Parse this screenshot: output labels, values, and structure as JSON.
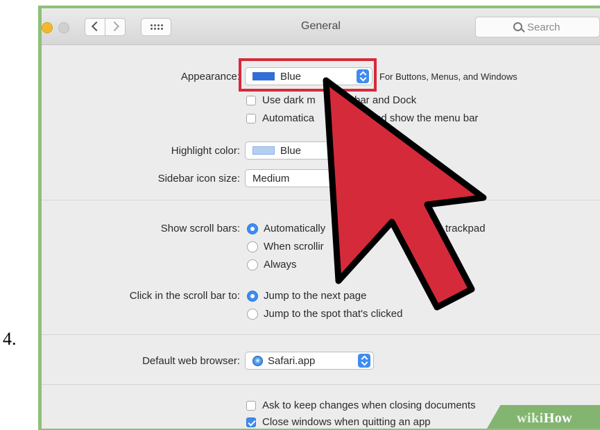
{
  "step": {
    "number": "4."
  },
  "window": {
    "title": "General",
    "search_placeholder": "Search"
  },
  "appearance": {
    "label": "Appearance:",
    "value": "Blue",
    "note": "For Buttons, Menus, and Windows",
    "swatch_color": "#2f6fdc",
    "dark_menu": {
      "label": "Use dark m",
      "label_tail": "bar and Dock",
      "checked": false
    },
    "auto_hide": {
      "label": "Automatica",
      "label_tail": "nd show the menu bar",
      "checked": false
    }
  },
  "highlight": {
    "label": "Highlight color:",
    "value": "Blue",
    "swatch_color": "#b5cff2"
  },
  "sidebar_icon_size": {
    "label": "Sidebar icon size:",
    "value": "Medium"
  },
  "scroll_bars": {
    "label": "Show scroll bars:",
    "options": [
      {
        "label": "Automatically",
        "label_tail": "e or trackpad",
        "selected": true
      },
      {
        "label": "When scrollir",
        "selected": false
      },
      {
        "label": "Always",
        "selected": false
      }
    ]
  },
  "click_scroll_bar": {
    "label": "Click in the scroll bar to:",
    "options": [
      {
        "label": "Jump to the next page",
        "selected": true
      },
      {
        "label": "Jump to the spot that's clicked",
        "selected": false
      }
    ]
  },
  "default_browser": {
    "label": "Default web browser:",
    "value": "Safari.app"
  },
  "documents": {
    "ask_keep_changes": {
      "label": "Ask to keep changes when closing documents",
      "checked": false
    },
    "close_windows": {
      "label": "Close windows when quitting an app",
      "checked": true
    }
  },
  "colors": {
    "accent": "#3e8cf0",
    "callout_red": "#d52a3a",
    "frame_green": "#8fbf7a"
  },
  "watermark": {
    "part1": "wiki",
    "part2": "How"
  }
}
